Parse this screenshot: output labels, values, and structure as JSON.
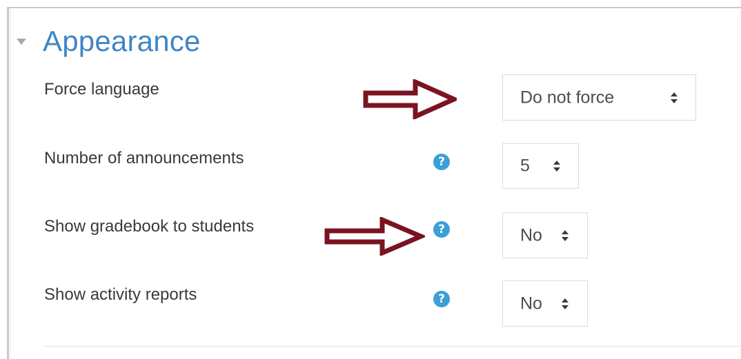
{
  "section": {
    "title": "Appearance"
  },
  "fields": [
    {
      "label": "Force language",
      "value": "Do not force",
      "has_help": false
    },
    {
      "label": "Number of announcements",
      "value": "5",
      "has_help": true
    },
    {
      "label": "Show gradebook to students",
      "value": "No",
      "has_help": true
    },
    {
      "label": "Show activity reports",
      "value": "No",
      "has_help": true
    }
  ],
  "icons": {
    "help": "?",
    "collapse": "caret-down-icon",
    "select_caret": "up-down-caret-icon",
    "annotation": "outline-arrow-right-icon"
  },
  "colors": {
    "title": "#3f86c4",
    "help_icon": "#3aa0d8",
    "annotation_arrow": "#7a1420",
    "label_text": "#373a3c"
  }
}
